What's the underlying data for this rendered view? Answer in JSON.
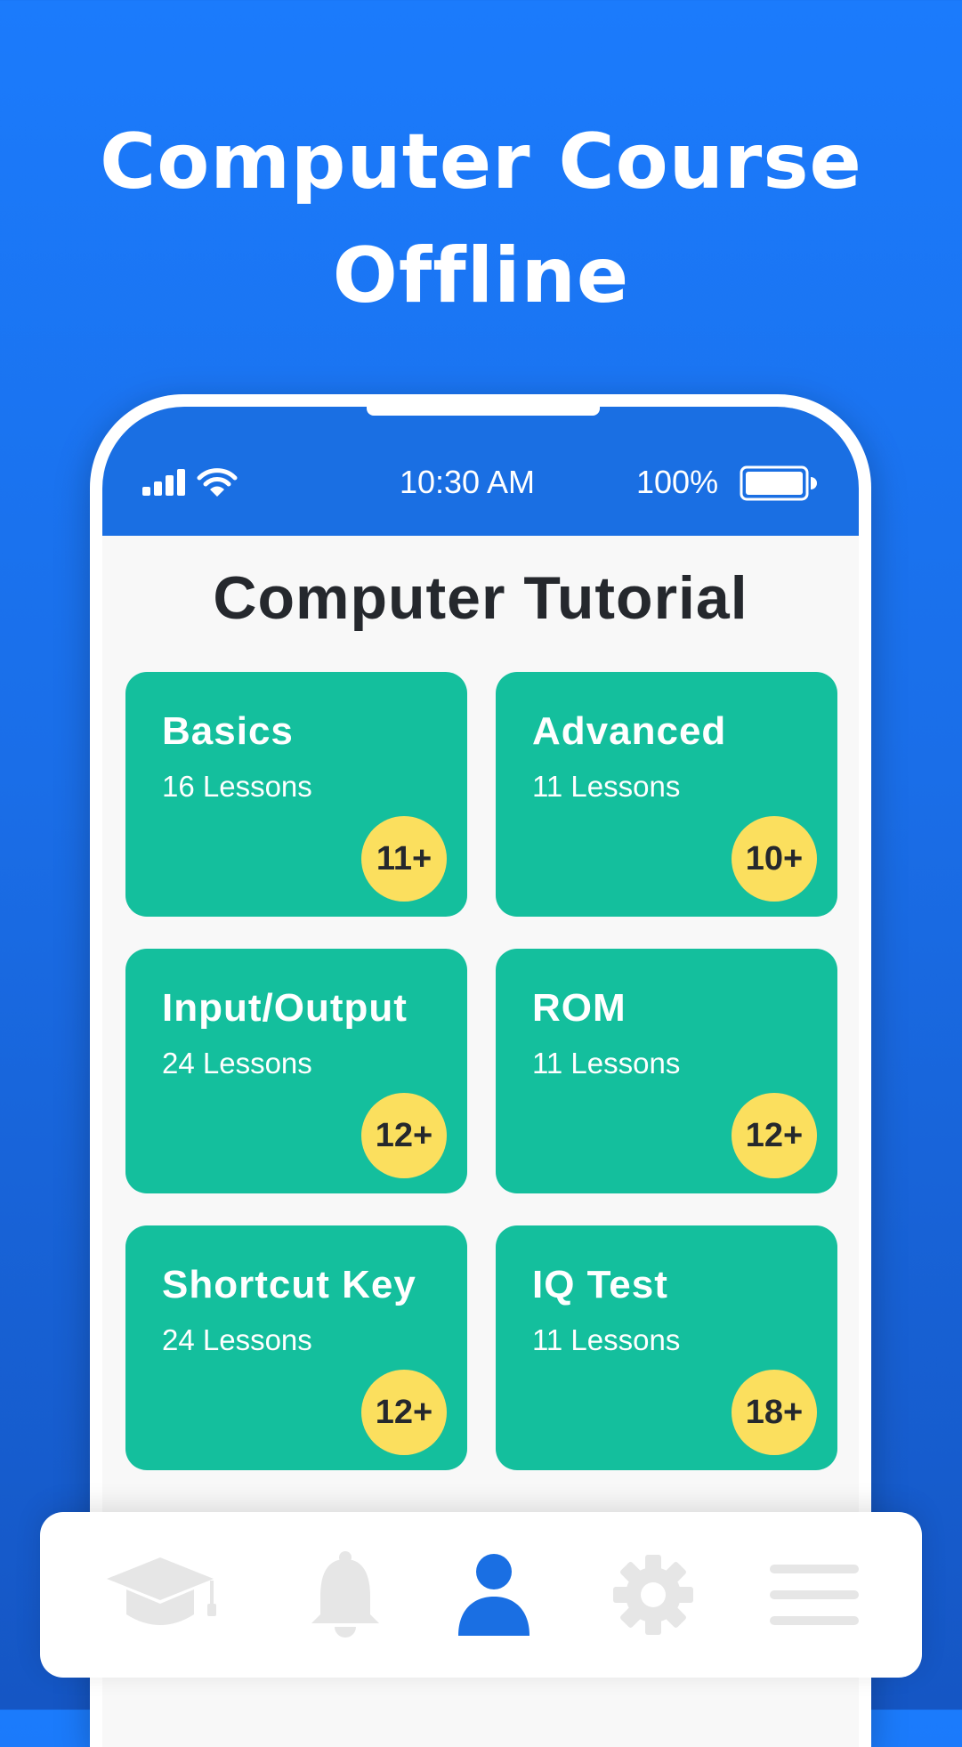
{
  "hero": {
    "title_line1": "Computer Course",
    "title_line2": "Offline"
  },
  "status_bar": {
    "time": "10:30 AM",
    "battery": "100%",
    "icons": [
      "signal-icon",
      "wifi-icon",
      "battery-icon"
    ]
  },
  "screen": {
    "title": "Computer Tutorial"
  },
  "courses": [
    {
      "title": "Basics",
      "lessons": "16 Lessons",
      "badge": "11+"
    },
    {
      "title": "Advanced",
      "lessons": "11 Lessons",
      "badge": "10+"
    },
    {
      "title": "Input/Output",
      "lessons": "24 Lessons",
      "badge": "12+"
    },
    {
      "title": "ROM",
      "lessons": "11 Lessons",
      "badge": "12+"
    },
    {
      "title": "Shortcut Key",
      "lessons": "24 Lessons",
      "badge": "12+"
    },
    {
      "title": "IQ Test",
      "lessons": "11 Lessons",
      "badge": "18+"
    }
  ],
  "bottom_nav": {
    "items": [
      "graduation-cap-icon",
      "bell-icon",
      "profile-icon",
      "gear-icon",
      "menu-icon"
    ],
    "active": "profile-icon"
  },
  "colors": {
    "background": "#1b7bfc",
    "status_bar": "#1a6fe3",
    "card": "#14bf9d",
    "badge": "#fbdf5e",
    "nav_active": "#1a6fe3",
    "nav_inactive": "#e6e6e6"
  }
}
